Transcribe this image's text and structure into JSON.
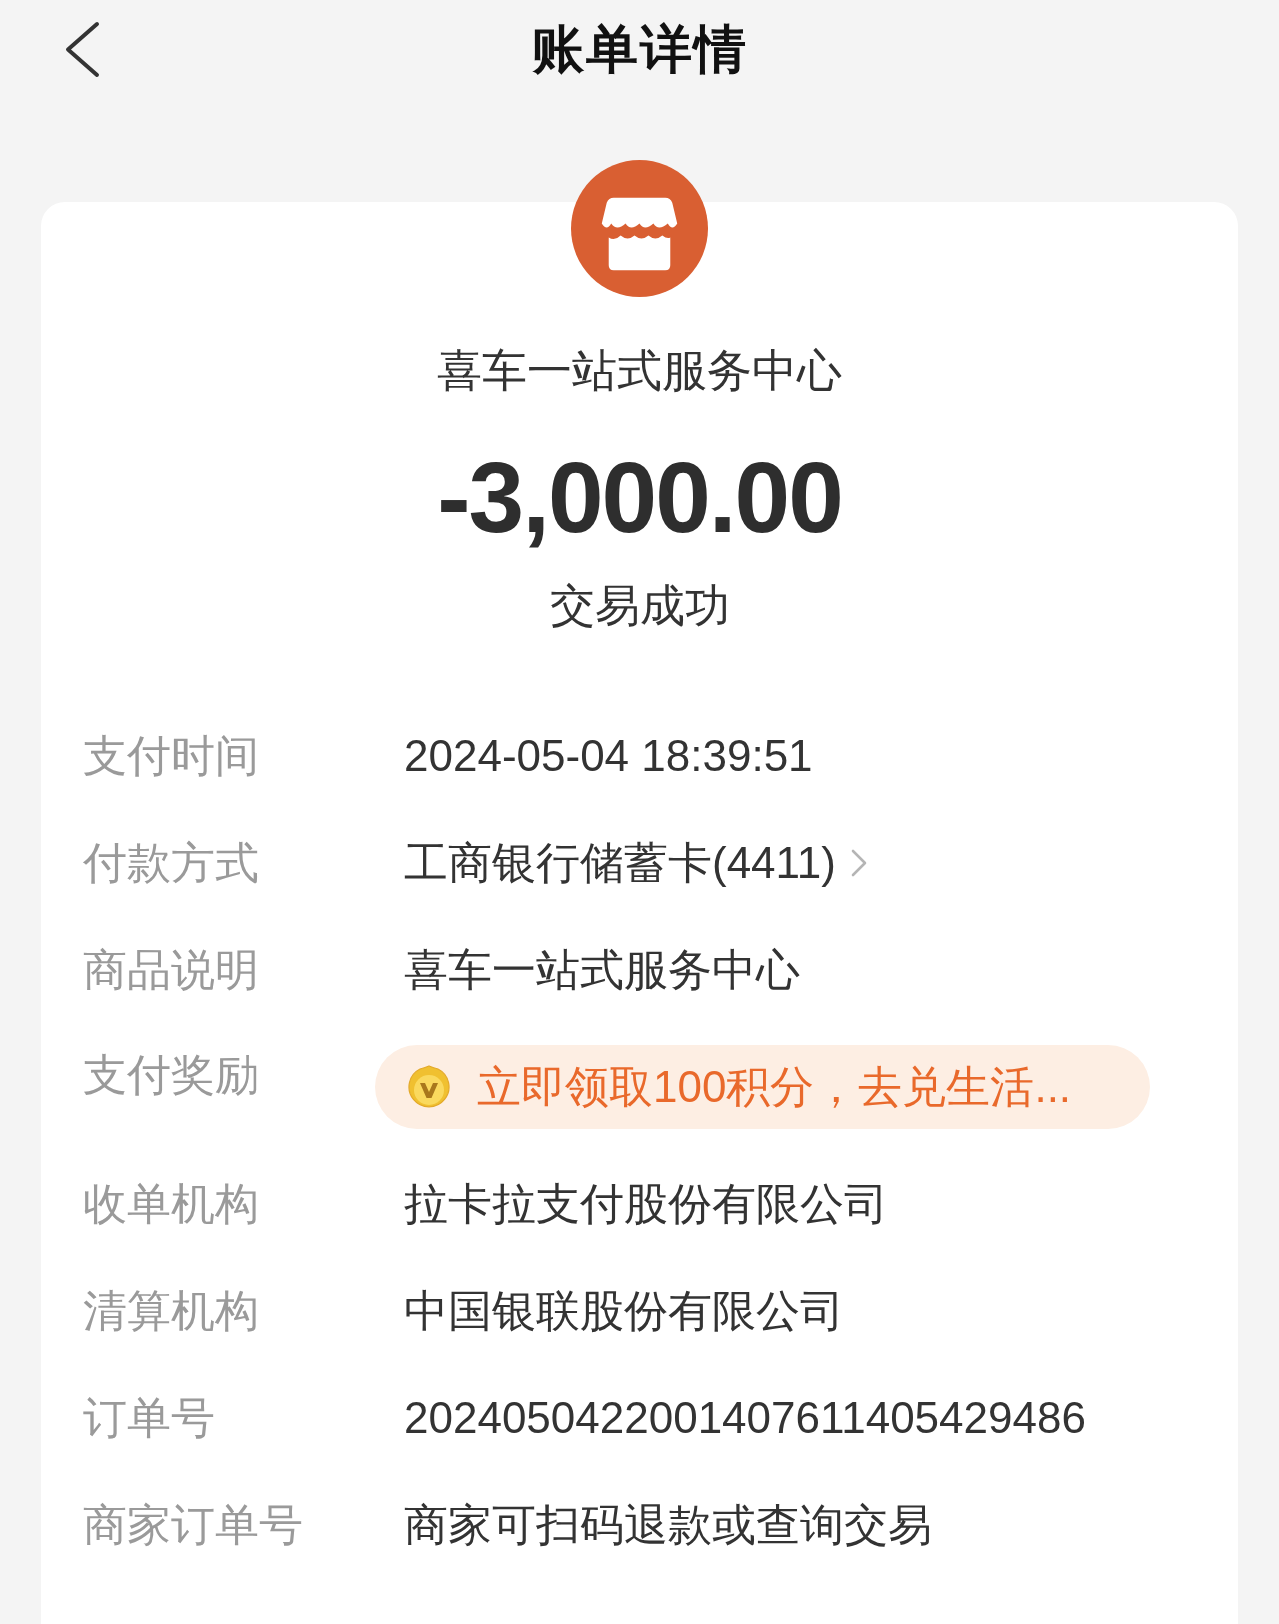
{
  "header": {
    "title": "账单详情"
  },
  "merchant": {
    "name": "喜车一站式服务中心"
  },
  "amount": "-3,000.00",
  "status": "交易成功",
  "details": [
    {
      "kind": "text",
      "label": "支付时间",
      "value": "2024-05-04 18:39:51"
    },
    {
      "kind": "link",
      "label": "付款方式",
      "value": "工商银行储蓄卡(4411)"
    },
    {
      "kind": "text",
      "label": "商品说明",
      "value": "喜车一站式服务中心"
    },
    {
      "kind": "reward",
      "label": "支付奖励",
      "value": "立即领取100积分，去兑生活..."
    },
    {
      "kind": "text",
      "label": "收单机构",
      "value": "拉卡拉支付股份有限公司"
    },
    {
      "kind": "text",
      "label": "清算机构",
      "value": "中国银联股份有限公司"
    },
    {
      "kind": "text",
      "label": "订单号",
      "value": "2024050422001407611405429486"
    },
    {
      "kind": "text",
      "label": "商家订单号",
      "value": "商家可扫码退款或查询交易"
    }
  ]
}
